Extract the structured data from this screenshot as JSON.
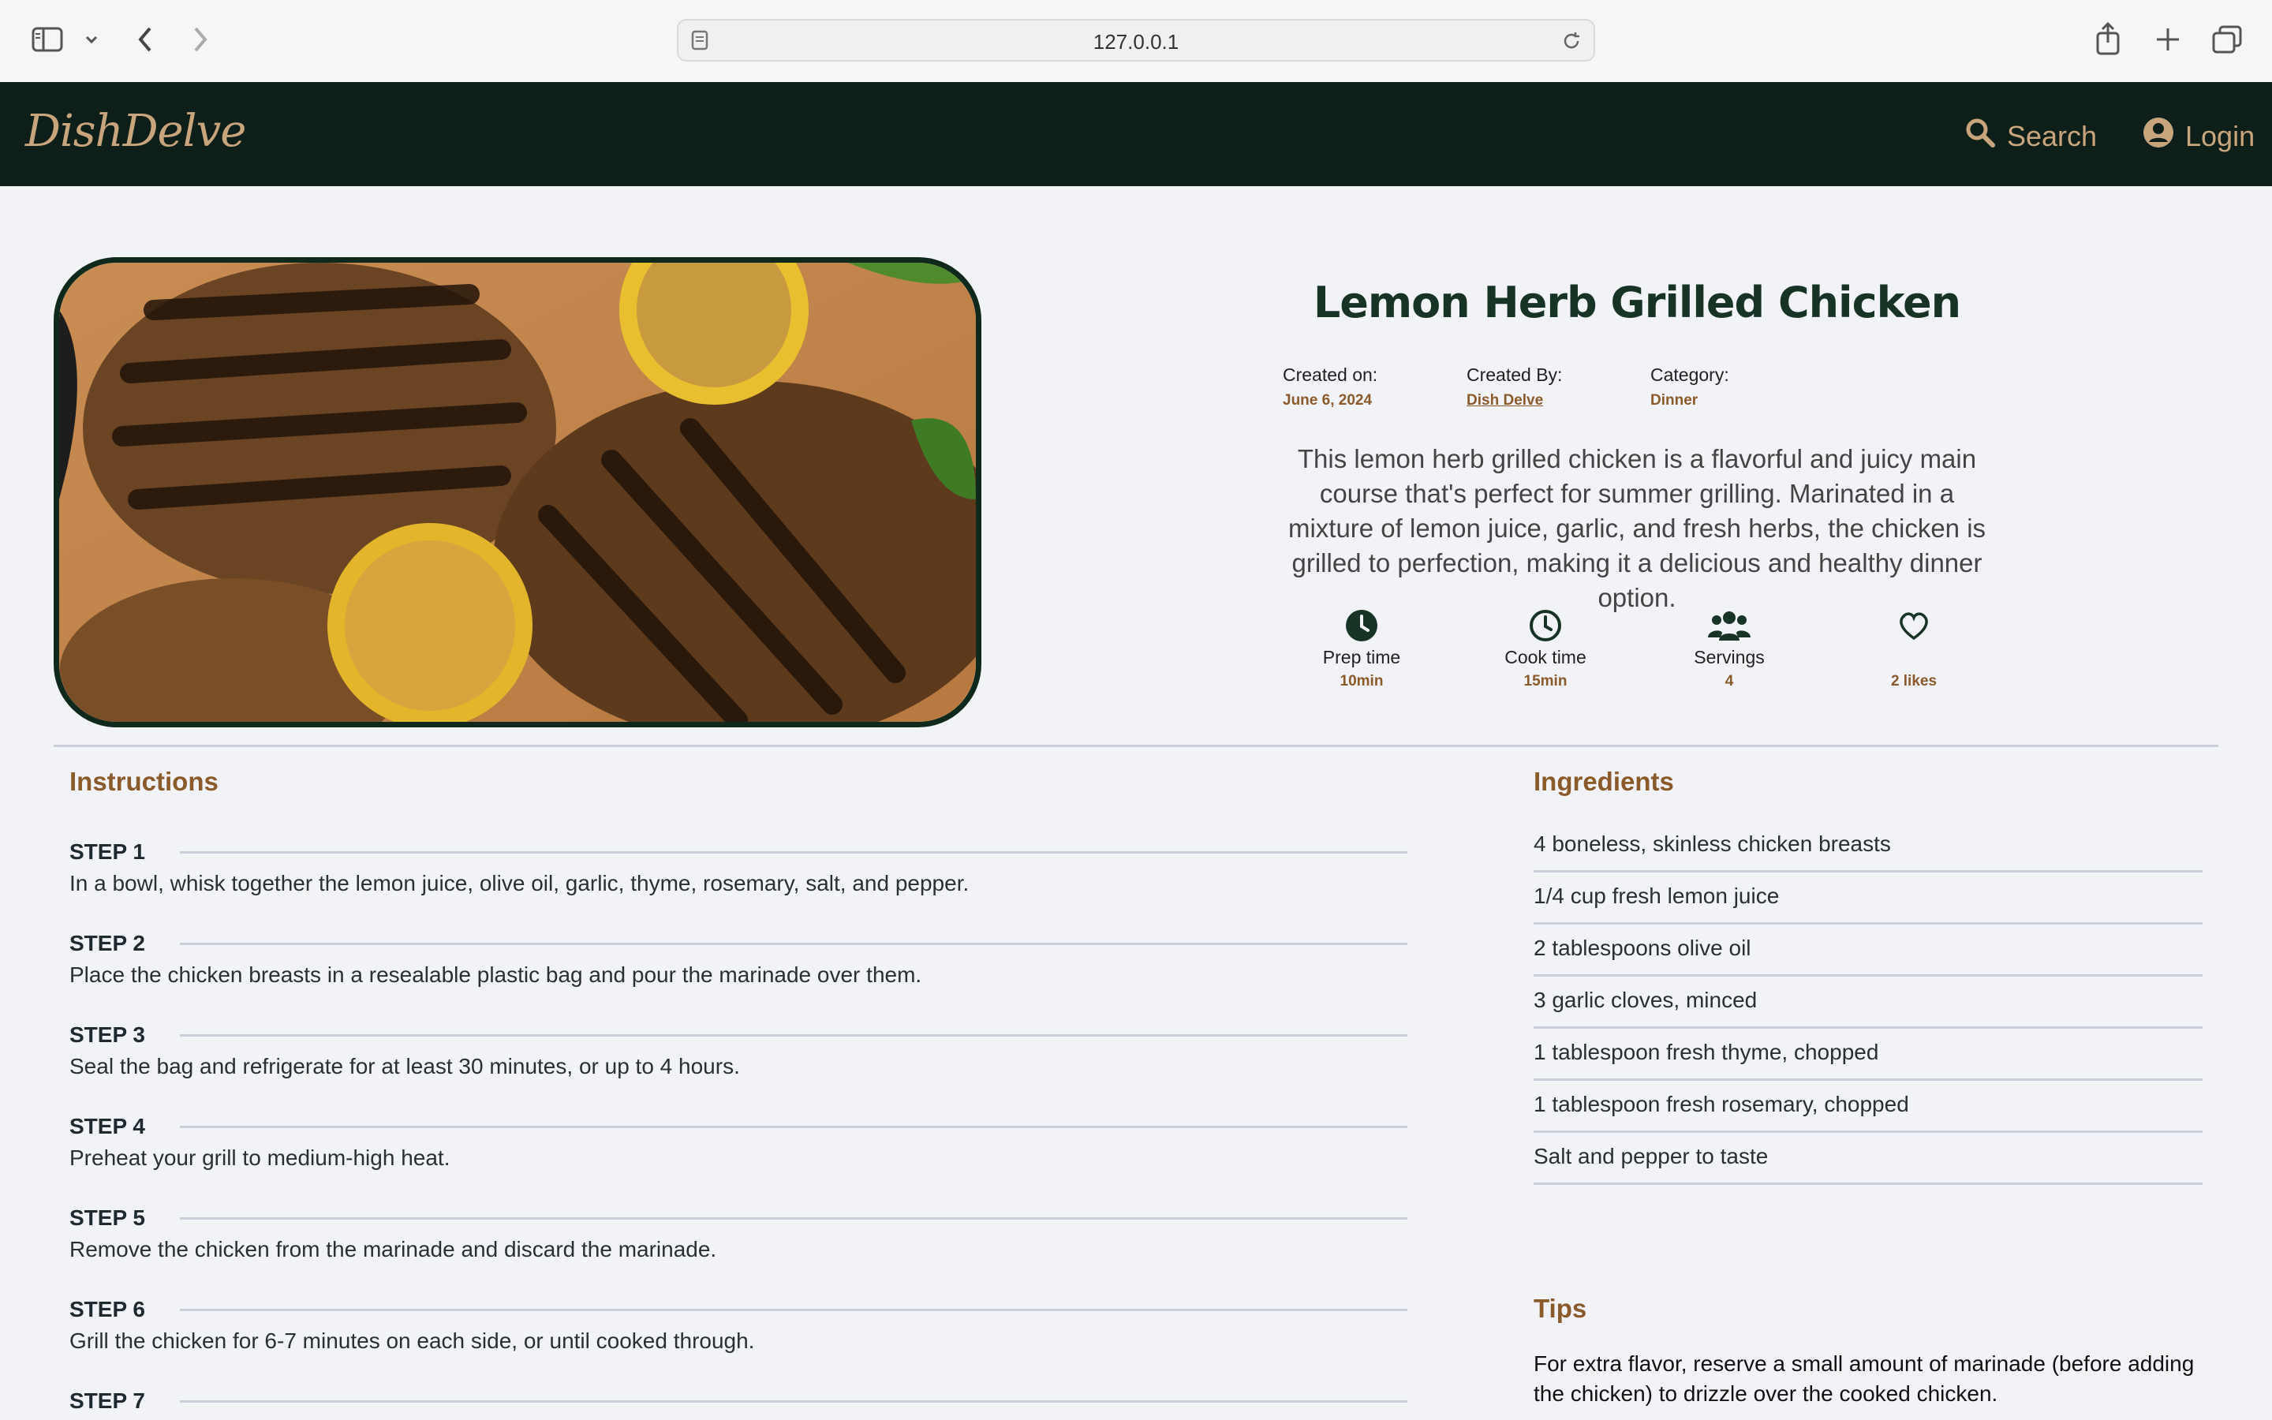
{
  "browser": {
    "url": "127.0.0.1"
  },
  "nav": {
    "logo": "DishDelve",
    "search_label": "Search",
    "login_label": "Login"
  },
  "recipe": {
    "title": "Lemon Herb Grilled Chicken",
    "meta": {
      "created_on_label": "Created on:",
      "created_on": "June 6, 2024",
      "created_by_label": "Created By:",
      "created_by": "Dish Delve",
      "category_label": "Category:",
      "category": "Dinner"
    },
    "description": "This lemon herb grilled chicken is a flavorful and juicy main course that's perfect for summer grilling. Marinated in a mixture of lemon juice, garlic, and fresh herbs, the chicken is grilled to perfection, making it a delicious and healthy dinner option.",
    "stats": {
      "prep_label": "Prep time",
      "prep_value": "10min",
      "cook_label": "Cook time",
      "cook_value": "15min",
      "servings_label": "Servings",
      "servings_value": "4",
      "likes_value": "2 likes"
    }
  },
  "instructions": {
    "heading": "Instructions",
    "steps": [
      {
        "label": "STEP 1",
        "text": "In a bowl, whisk together the lemon juice, olive oil, garlic, thyme, rosemary, salt, and pepper."
      },
      {
        "label": "STEP 2",
        "text": "Place the chicken breasts in a resealable plastic bag and pour the marinade over them."
      },
      {
        "label": "STEP 3",
        "text": "Seal the bag and refrigerate for at least 30 minutes, or up to 4 hours."
      },
      {
        "label": "STEP 4",
        "text": "Preheat your grill to medium-high heat."
      },
      {
        "label": "STEP 5",
        "text": "Remove the chicken from the marinade and discard the marinade."
      },
      {
        "label": "STEP 6",
        "text": "Grill the chicken for 6-7 minutes on each side, or until cooked through."
      },
      {
        "label": "STEP 7",
        "text": ""
      }
    ]
  },
  "ingredients": {
    "heading": "Ingredients",
    "items": [
      "4 boneless, skinless chicken breasts",
      "1/4 cup fresh lemon juice",
      "2 tablespoons olive oil",
      "3 garlic cloves, minced",
      "1 tablespoon fresh thyme, chopped",
      "1 tablespoon fresh rosemary, chopped",
      "Salt and pepper to taste"
    ]
  },
  "tips": {
    "heading": "Tips",
    "text": "For extra flavor, reserve a small amount of marinade (before adding the chicken) to drizzle over the cooked chicken."
  },
  "colors": {
    "nav_bg": "#0e1f19",
    "accent": "#c9a57e",
    "brown": "#8a5a2b",
    "title_green": "#173325"
  }
}
